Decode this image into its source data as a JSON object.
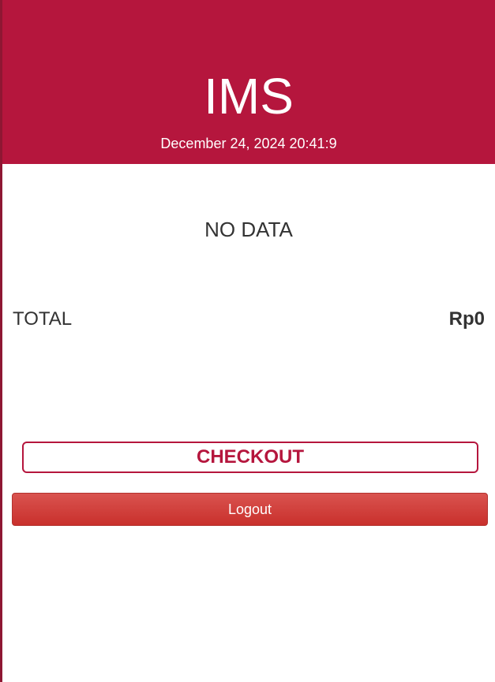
{
  "header": {
    "title": "IMS",
    "datetime": "December 24, 2024 20:41:9",
    "background_color": "#b5163d"
  },
  "cart": {
    "empty_message": "NO DATA",
    "total_label": "TOTAL",
    "total_value": "Rp0"
  },
  "actions": {
    "checkout_label": "CHECKOUT",
    "logout_label": "Logout",
    "checkout_color": "#b5163d",
    "logout_color": "#d9534f"
  }
}
